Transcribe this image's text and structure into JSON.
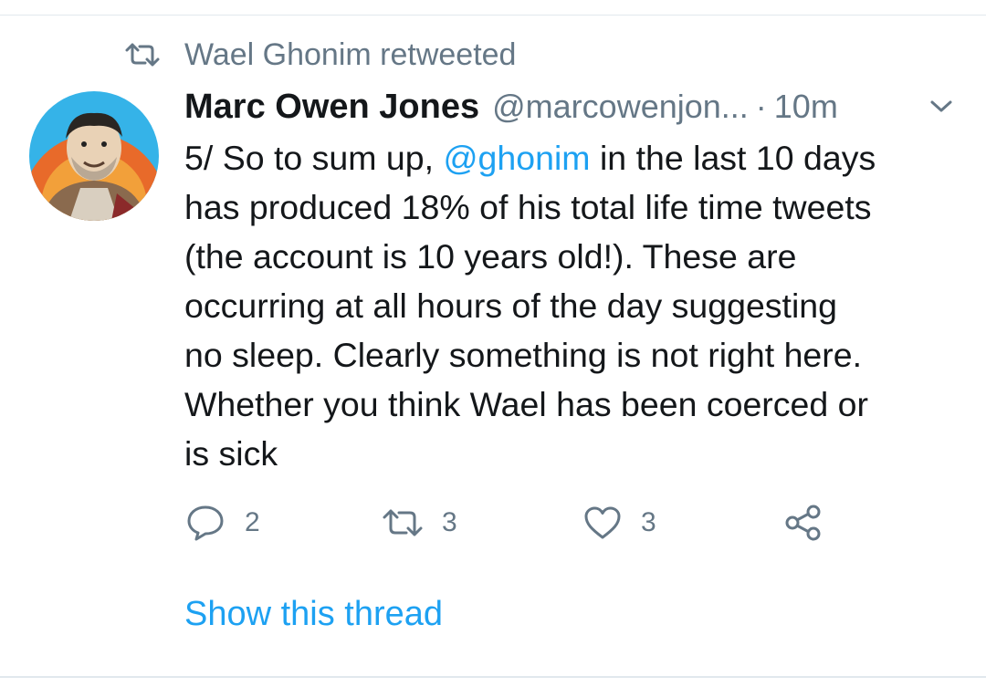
{
  "retweet_context": {
    "icon": "retweet-icon",
    "text": "Wael Ghonim retweeted"
  },
  "tweet": {
    "author_name": "Marc Owen Jones",
    "author_handle": "@marcowenjon...",
    "separator": "·",
    "time": "10m",
    "text_before": "5/ So to sum up, ",
    "mention": "@ghonim",
    "text_line1_after": " in the last 10 days",
    "text_line2": "has produced 18% of his total life time tweets",
    "text_line3": "(the account is 10 years old!). These are",
    "text_line4": "occurring at all hours of the day suggesting",
    "text_line5": "no sleep. Clearly something is not right here.",
    "text_line6": "Whether you think Wael has been coerced or",
    "text_line7": "is sick",
    "reply_count": "2",
    "retweet_count": "3",
    "like_count": "3"
  },
  "show_thread_label": "Show this thread",
  "colors": {
    "link": "#1da1f2",
    "secondary_text": "#657786",
    "primary_text": "#14171a",
    "divider": "#e1e8ed"
  }
}
